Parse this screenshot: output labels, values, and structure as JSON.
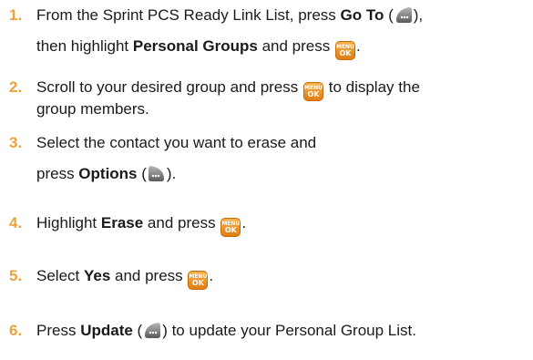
{
  "steps": [
    {
      "num": "1.",
      "lines": [
        {
          "t1": "From the Sprint PCS Ready Link List, press ",
          "b1": "Go To",
          "t2": " (",
          "t3": "),"
        },
        {
          "t1": "then highlight ",
          "b1": "Personal Groups",
          "t2": " and press ",
          "t3": "."
        }
      ]
    },
    {
      "num": "2.",
      "lines": [
        {
          "t1": "Scroll to your desired group and press ",
          "t2": " to display the"
        },
        {
          "t1": "group members."
        }
      ]
    },
    {
      "num": "3.",
      "lines": [
        {
          "t1": "Select the contact you want to erase and"
        },
        {
          "t1": "press ",
          "b1": "Options",
          "t2": " (",
          "t3": ")."
        }
      ]
    },
    {
      "num": "4.",
      "lines": [
        {
          "t1": "Highlight ",
          "b1": "Erase",
          "t2": " and press ",
          "t3": "."
        }
      ]
    },
    {
      "num": "5.",
      "lines": [
        {
          "t1": "Select ",
          "b1": "Yes",
          "t2": " and press ",
          "t3": "."
        }
      ]
    },
    {
      "num": "6.",
      "lines": [
        {
          "t1": "Press ",
          "b1": "Update",
          "t2": " (",
          "t3": ") to update your Personal Group List."
        }
      ]
    }
  ],
  "keys": {
    "menu_top": "MENU",
    "menu_bottom": "OK"
  },
  "colors": {
    "step_number": "#e8a33b",
    "menu_key": "#f0961f",
    "softkey": "#8c8c8c"
  },
  "icons": [
    "left-softkey-icon",
    "right-softkey-icon",
    "menu-ok-key-icon"
  ]
}
